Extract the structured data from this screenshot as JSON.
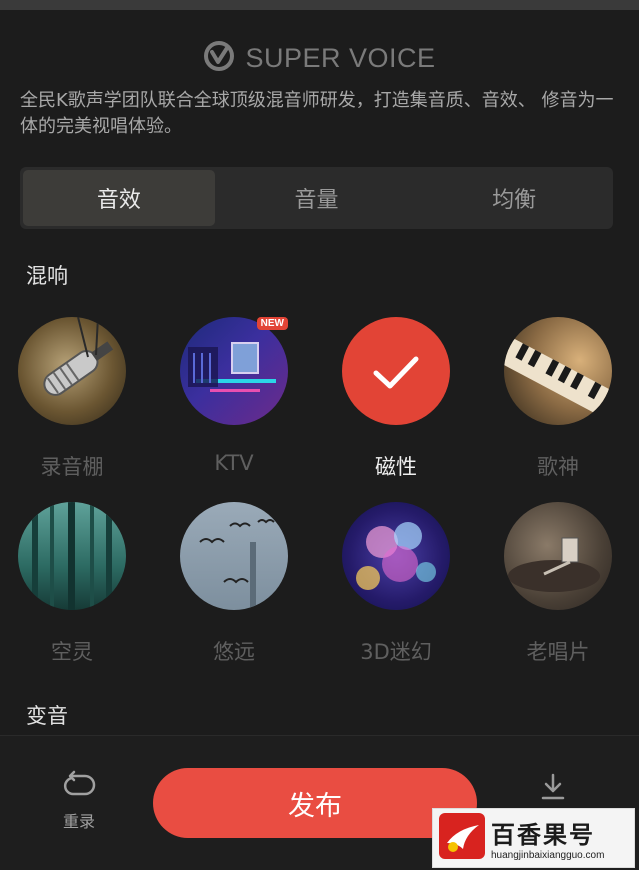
{
  "brand": {
    "name": "SUPER VOICE"
  },
  "description": "全民K歌声学团队联合全球顶级混音师研发，打造集音质、音效、 修音为一体的完美视唱体验。",
  "tabs": [
    {
      "label": "音效",
      "active": true
    },
    {
      "label": "音量",
      "active": false
    },
    {
      "label": "均衡",
      "active": false
    }
  ],
  "sections": {
    "reverb": "混响",
    "voice_change": "变音"
  },
  "effects": [
    {
      "label": "录音棚",
      "selected": false
    },
    {
      "label": "KTV",
      "selected": false,
      "badge": "NEW"
    },
    {
      "label": "磁性",
      "selected": true
    },
    {
      "label": "歌神",
      "selected": false
    },
    {
      "label": "空灵",
      "selected": false
    },
    {
      "label": "悠远",
      "selected": false
    },
    {
      "label": "3D迷幻",
      "selected": false
    },
    {
      "label": "老唱片",
      "selected": false
    }
  ],
  "bottom": {
    "rerecord_label": "重录",
    "publish_label": "发布"
  },
  "watermark": {
    "title": "百香果号",
    "url": "huangjinbaixiangguo.com"
  },
  "colors": {
    "background": "#1c1c1c",
    "accent": "#e94d42",
    "selected_effect": "#e24436"
  }
}
